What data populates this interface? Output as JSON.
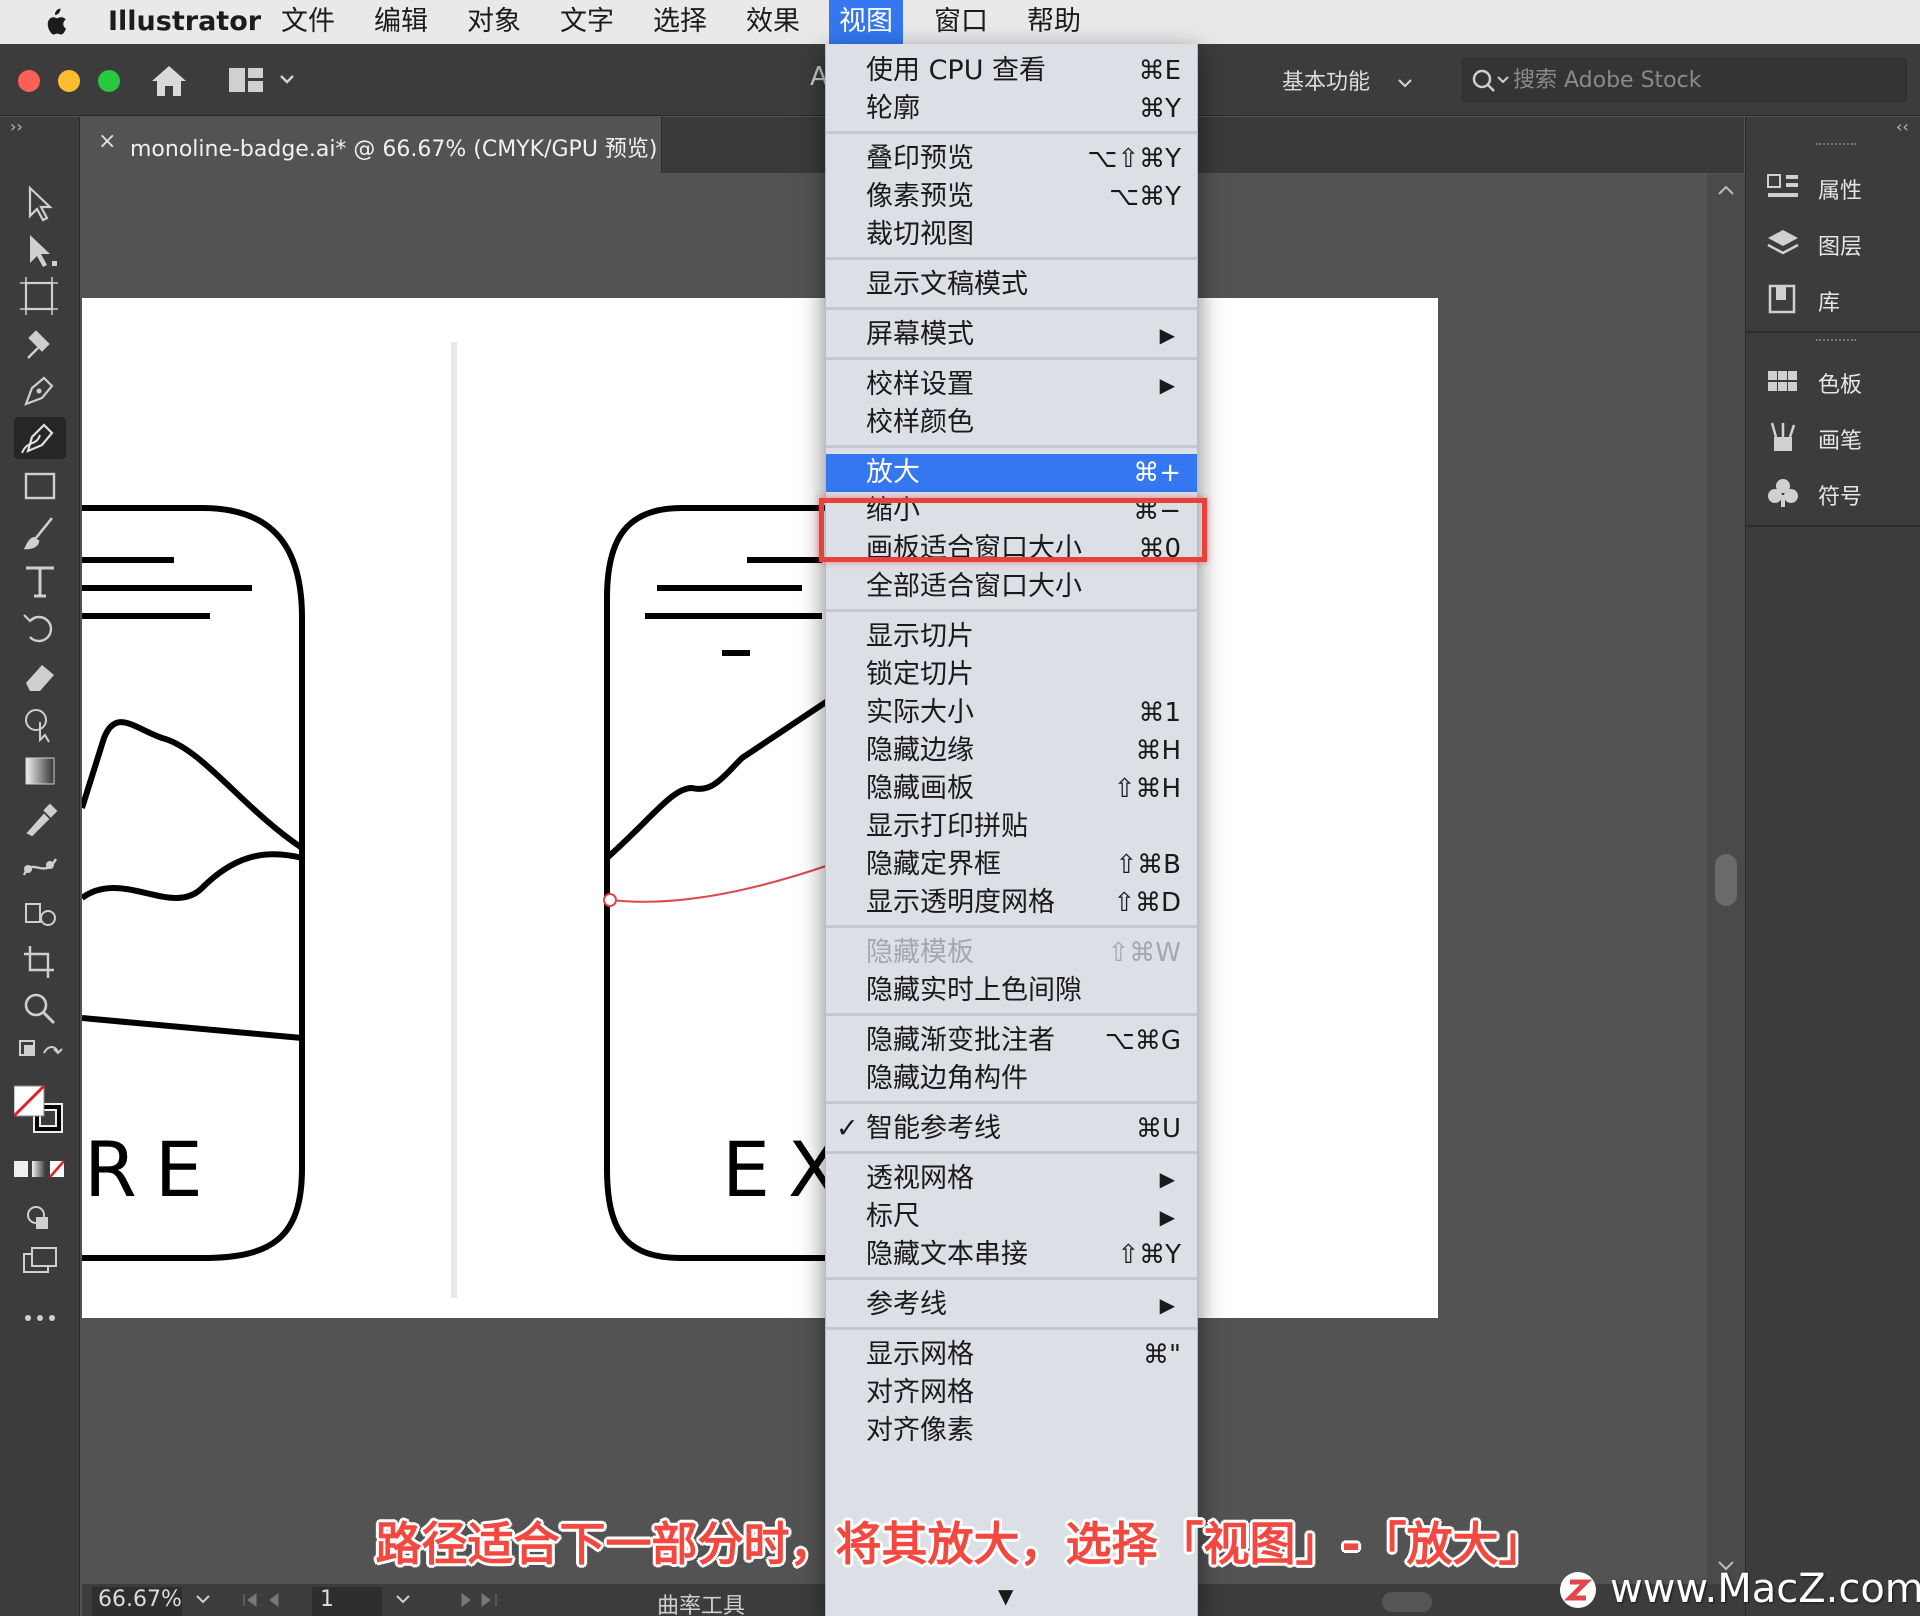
{
  "menubar": {
    "app_name": "Illustrator",
    "items": [
      "文件",
      "编辑",
      "对象",
      "文字",
      "选择",
      "效果",
      "视图",
      "窗口",
      "帮助"
    ],
    "active_item": "视图"
  },
  "titlebar": {
    "title_fragment": "A",
    "workspace": "基本功能",
    "search_placeholder": "搜索 Adobe Stock"
  },
  "document_tab": {
    "close_glyph": "×",
    "title": "monoline-badge.ai* @ 66.67% (CMYK/GPU 预览)"
  },
  "view_menu": {
    "groups": [
      [
        {
          "label": "使用 CPU 查看",
          "shortcut": "⌘E"
        },
        {
          "label": "轮廓",
          "shortcut": "⌘Y"
        }
      ],
      [
        {
          "label": "叠印预览",
          "shortcut": "⌥⇧⌘Y"
        },
        {
          "label": "像素预览",
          "shortcut": "⌥⌘Y"
        },
        {
          "label": "裁切视图",
          "shortcut": ""
        }
      ],
      [
        {
          "label": "显示文稿模式",
          "shortcut": ""
        }
      ],
      [
        {
          "label": "屏幕模式",
          "shortcut": "",
          "submenu": true
        }
      ],
      [
        {
          "label": "校样设置",
          "shortcut": "",
          "submenu": true
        },
        {
          "label": "校样颜色",
          "shortcut": ""
        }
      ],
      [
        {
          "label": "放大",
          "shortcut": "⌘+",
          "highlighted": true
        },
        {
          "label": "缩小",
          "shortcut": "⌘−"
        },
        {
          "label": "画板适合窗口大小",
          "shortcut": "⌘0"
        },
        {
          "label": "全部适合窗口大小",
          "shortcut": ""
        }
      ],
      [
        {
          "label": "显示切片",
          "shortcut": ""
        },
        {
          "label": "锁定切片",
          "shortcut": ""
        },
        {
          "label": "实际大小",
          "shortcut": "⌘1"
        },
        {
          "label": "隐藏边缘",
          "shortcut": "⌘H"
        },
        {
          "label": "隐藏画板",
          "shortcut": "⇧⌘H"
        },
        {
          "label": "显示打印拼贴",
          "shortcut": ""
        },
        {
          "label": "隐藏定界框",
          "shortcut": "⇧⌘B"
        },
        {
          "label": "显示透明度网格",
          "shortcut": "⇧⌘D"
        }
      ],
      [
        {
          "label": "隐藏模板",
          "shortcut": "⇧⌘W",
          "disabled": true
        },
        {
          "label": "隐藏实时上色间隙",
          "shortcut": ""
        }
      ],
      [
        {
          "label": "隐藏渐变批注者",
          "shortcut": "⌥⌘G"
        },
        {
          "label": "隐藏边角构件",
          "shortcut": ""
        }
      ],
      [
        {
          "label": "智能参考线",
          "shortcut": "⌘U",
          "checked": true
        }
      ],
      [
        {
          "label": "透视网格",
          "shortcut": "",
          "submenu": true
        },
        {
          "label": "标尺",
          "shortcut": "",
          "submenu": true
        },
        {
          "label": "隐藏文本串接",
          "shortcut": "⇧⌘Y"
        }
      ],
      [
        {
          "label": "参考线",
          "shortcut": "",
          "submenu": true
        }
      ],
      [
        {
          "label": "显示网格",
          "shortcut": "⌘\""
        },
        {
          "label": "对齐网格",
          "shortcut": ""
        },
        {
          "label": "对齐像素",
          "shortcut": ""
        }
      ]
    ],
    "more_glyph": "▼"
  },
  "right_panel": {
    "group1": [
      {
        "label": "属性",
        "icon": "properties-icon"
      },
      {
        "label": "图层",
        "icon": "layers-icon"
      },
      {
        "label": "库",
        "icon": "libraries-icon"
      }
    ],
    "group2": [
      {
        "label": "色板",
        "icon": "swatches-icon"
      },
      {
        "label": "画笔",
        "icon": "brushes-icon"
      },
      {
        "label": "符号",
        "icon": "symbols-icon"
      }
    ]
  },
  "artwork_text": {
    "left_badge": "RE",
    "right_badge": "EX"
  },
  "statusbar": {
    "zoom": "66.67%",
    "page": "1",
    "current_tool": "曲率工具"
  },
  "caption": "路径适合下一部分时，将其放大，选择「视图」-「放大」",
  "watermark": "www.MacZ.com",
  "colors": {
    "menu_highlight": "#3477f0",
    "annotation_red": "#e8403a",
    "path_red": "#e0474c"
  }
}
